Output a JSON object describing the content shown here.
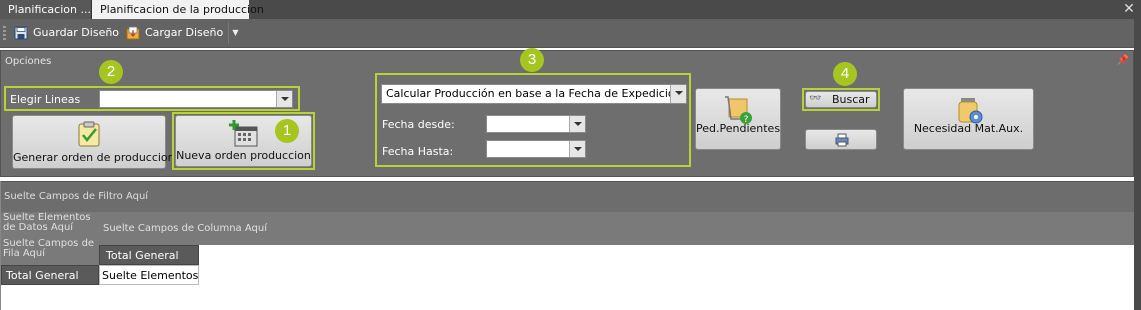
{
  "tabs": [
    {
      "label": "Planificacion ..."
    },
    {
      "label": "Planificacion de la produccion"
    }
  ],
  "toolbar": {
    "guardar_label": "Guardar Diseño",
    "cargar_label": "Cargar Diseño"
  },
  "opciones": {
    "title": "Opciones",
    "elegir_lineas_label": "Elegir Lineas",
    "elegir_lineas_value": "",
    "generar_button": "Generar orden de produccion",
    "nueva_button": "Nueva orden produccion",
    "calcular_select": "Calcular Producción en base a la Fecha de Expedición",
    "fecha_desde_label": "Fecha desde:",
    "fecha_desde_value": "",
    "fecha_hasta_label": "Fecha Hasta:",
    "fecha_hasta_value": "",
    "ped_pendientes_button": "Ped.Pendientes",
    "buscar_button": "Buscar",
    "necesidad_button": "Necesidad Mat.Aux."
  },
  "badges": [
    "1",
    "2",
    "3",
    "4"
  ],
  "pivot": {
    "filter_area": "Suelte Campos de Filtro Aquí",
    "data_area": "Suelte Elementos de Datos Aquí",
    "column_area": "Suelte Campos de Columna Aquí",
    "row_area": "Suelte Campos de Fila Aquí",
    "total_general_col": "Total General",
    "total_general_row": "Total General",
    "data_cell": "Suelte Elementos de"
  },
  "colors": {
    "highlight": "#b5d334",
    "badge": "#a7c520",
    "panel": "#6e6e6e"
  }
}
